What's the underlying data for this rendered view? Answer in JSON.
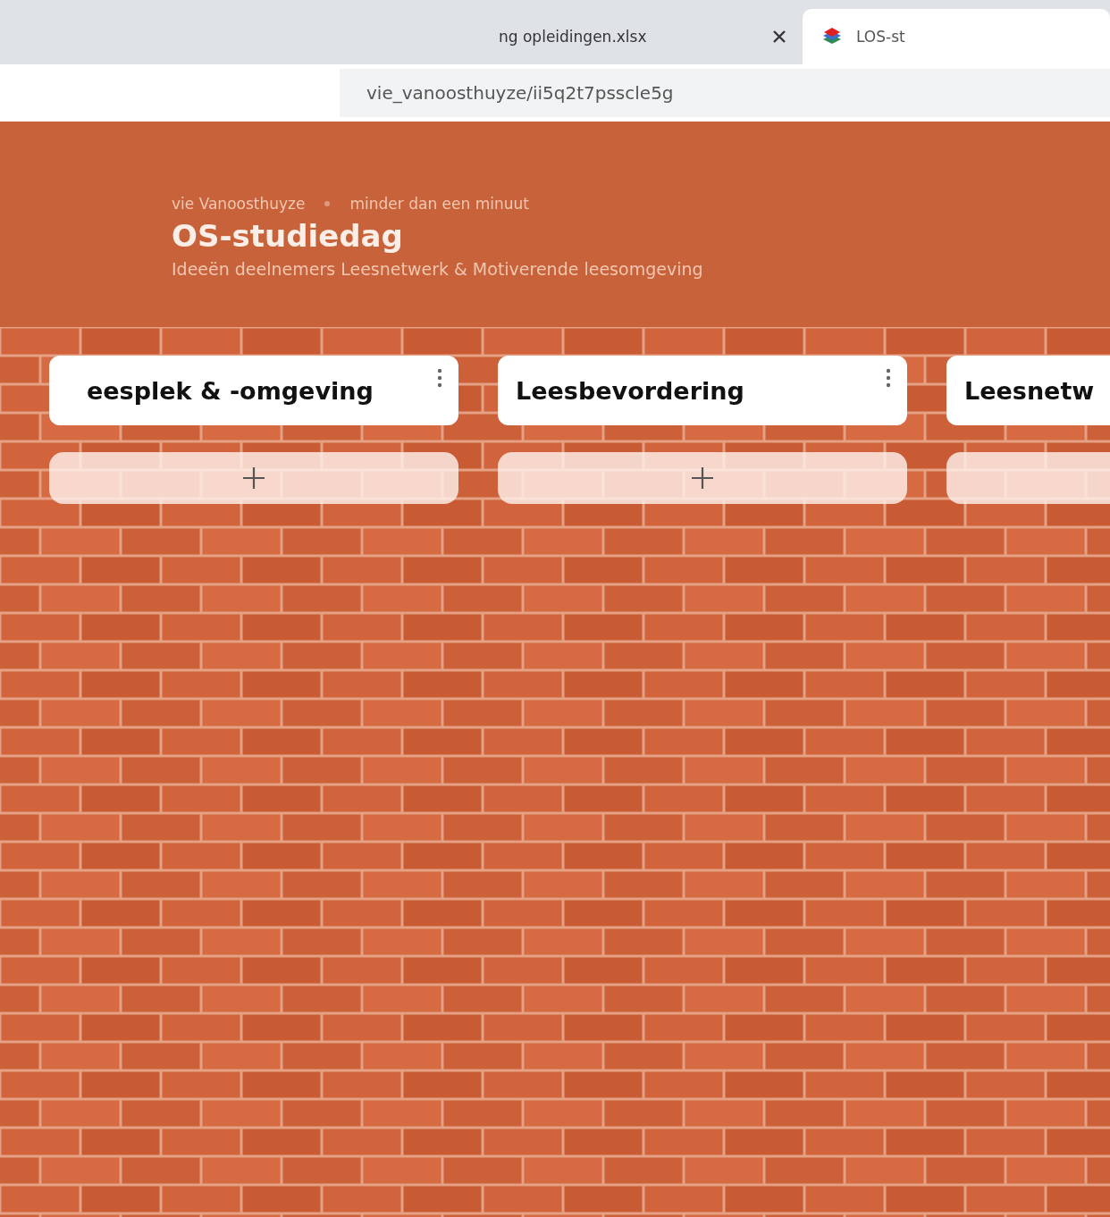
{
  "browser": {
    "tabs": [
      {
        "title": "ng opleidingen.xlsx",
        "selected": false,
        "closable": true
      },
      {
        "title": "LOS-st",
        "selected": true,
        "closable": false
      }
    ],
    "address": "vie_vanoosthuyze/ii5q2t7psscle5g"
  },
  "header": {
    "author": "vie Vanoosthuyze",
    "time": "minder dan een minuut",
    "title": "OS-studiedag",
    "description": "Ideeën deelnemers Leesnetwerk & Motiverende leesomgeving"
  },
  "columns": [
    {
      "title": "eesplek & -omgeving",
      "menu": true
    },
    {
      "title": "Leesbevordering",
      "menu": true
    },
    {
      "title": "Leesnetw"
    }
  ]
}
